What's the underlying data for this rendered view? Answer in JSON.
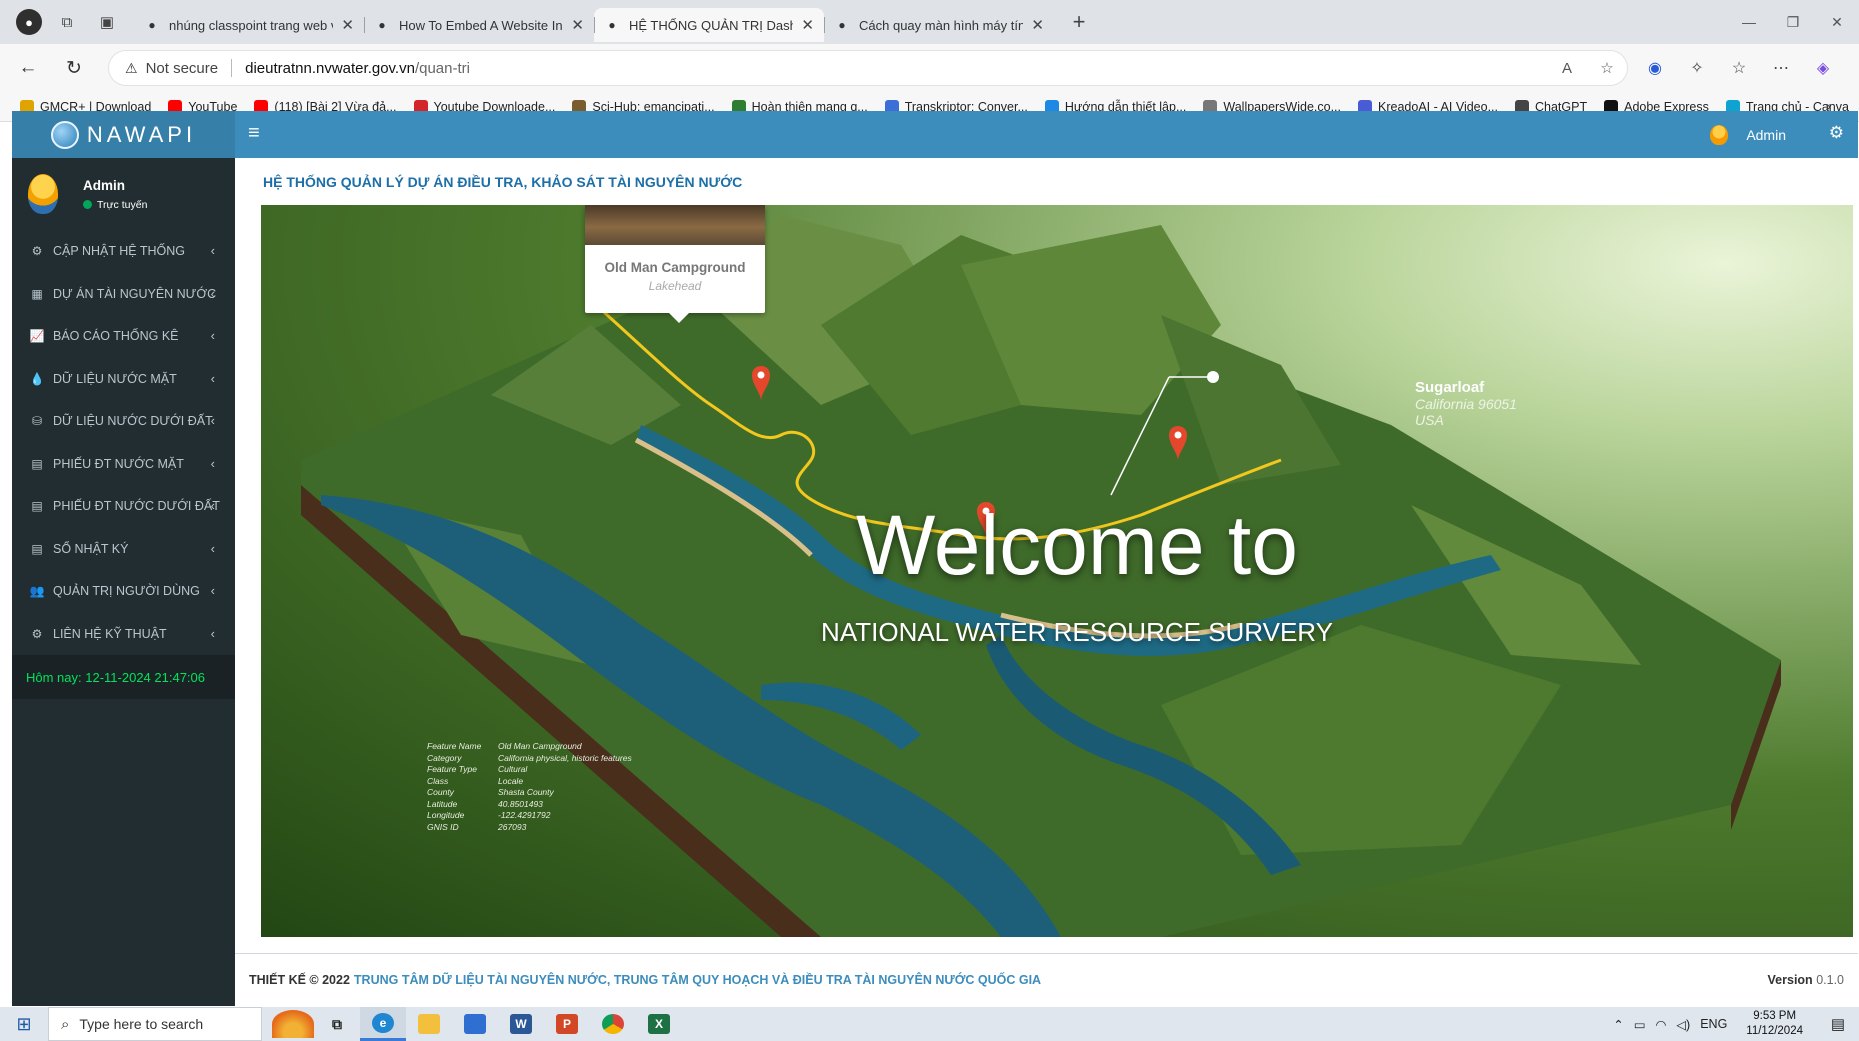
{
  "browser": {
    "tabs": [
      {
        "title": "nhúng classpoint trang web vào t",
        "favicon": "google-icon",
        "active": false
      },
      {
        "title": "How To Embed A Website In Pow",
        "favicon": "classpoint-icon",
        "active": false
      },
      {
        "title": "HỆ THỐNG QUẢN TRỊ Dashboard",
        "favicon": "page-icon",
        "active": true
      },
      {
        "title": "Cách quay màn hình máy tính nh",
        "favicon": "flash-icon",
        "active": false
      }
    ],
    "address": {
      "security_label": "Not secure",
      "host": "dieutratnn.nvwater.gov.vn",
      "path": "/quan-tri"
    },
    "bookmarks": [
      {
        "label": "GMCR+ | Download",
        "color": "#e0a400"
      },
      {
        "label": "YouTube",
        "color": "#ff0000"
      },
      {
        "label": "(118) [Bài 2] Vừa đả...",
        "color": "#ff0000"
      },
      {
        "label": "Youtube Downloade...",
        "color": "#d4252a"
      },
      {
        "label": "Sci-Hub: emancipati...",
        "color": "#7a5c2e"
      },
      {
        "label": "Hoàn thiện mạng q...",
        "color": "#2e7d32"
      },
      {
        "label": "Transkriptor: Conver...",
        "color": "#3a6fd8"
      },
      {
        "label": "Hướng dẫn thiết lập...",
        "color": "#1e88e5"
      },
      {
        "label": "WallpapersWide.co...",
        "color": "#777777"
      },
      {
        "label": "KreadoAI - AI Video...",
        "color": "#4a5bd6"
      },
      {
        "label": "ChatGPT",
        "color": "#444444"
      },
      {
        "label": "Adobe Express",
        "color": "#111111"
      },
      {
        "label": "Trang chủ - Canva",
        "color": "#0fa3d1"
      }
    ]
  },
  "app": {
    "logo_text": "NAWAPI",
    "top_user": "Admin",
    "sidebar": {
      "user_name": "Admin",
      "user_status": "Trực tuyến",
      "menu": [
        {
          "label": "CẬP NHẬT HỆ THỐNG",
          "icon": "gear-icon",
          "glyph": "⚙"
        },
        {
          "label": "DỰ ÁN TÀI NGUYÊN NƯỚC",
          "icon": "table-icon",
          "glyph": "▦"
        },
        {
          "label": "BÁO CÁO THỐNG KÊ",
          "icon": "line-chart-icon",
          "glyph": "📈"
        },
        {
          "label": "DỮ LIỆU NƯỚC MẶT",
          "icon": "water-drop-icon",
          "glyph": "💧"
        },
        {
          "label": "DỮ LIỆU NƯỚC DƯỚI ĐẤT",
          "icon": "underground-icon",
          "glyph": "⛁"
        },
        {
          "label": "PHIẾU ĐT NƯỚC MẶT",
          "icon": "document-icon",
          "glyph": "▤"
        },
        {
          "label": "PHIẾU ĐT NƯỚC DƯỚI ĐẤT",
          "icon": "document-icon",
          "glyph": "▤"
        },
        {
          "label": "SỔ NHẬT KÝ",
          "icon": "logbook-icon",
          "glyph": "▤"
        },
        {
          "label": "QUẢN TRỊ NGƯỜI DÙNG",
          "icon": "users-icon",
          "glyph": "👥"
        },
        {
          "label": "LIÊN HỆ KỸ THUẬT",
          "icon": "cogs-icon",
          "glyph": "⚙"
        }
      ],
      "today": "Hôm nay: 12-11-2024 21:47:06"
    },
    "content_title": "HỆ THỐNG QUẢN LÝ DỰ ÁN ĐIỀU TRA, KHẢO SÁT TÀI NGUYÊN NƯỚC",
    "banner": {
      "welcome": "Welcome to",
      "subtitle": "NATIONAL WATER RESOURCE SURVERY",
      "callout_name": "Old Man Campground",
      "callout_sub": "Lakehead",
      "sugarloaf_name": "Sugarloaf",
      "sugarloaf_line1": "California 96051",
      "sugarloaf_line2": "USA",
      "feature_rows": [
        {
          "k": "Feature Name",
          "v": "Old Man Campground"
        },
        {
          "k": "Category",
          "v": "California physical, historic features"
        },
        {
          "k": "Feature Type",
          "v": "Cultural"
        },
        {
          "k": "Class",
          "v": "Locale"
        },
        {
          "k": "County",
          "v": "Shasta County"
        },
        {
          "k": "Latitude",
          "v": "40.8501493"
        },
        {
          "k": "Longitude",
          "v": "-122.4291792"
        },
        {
          "k": "GNIS ID",
          "v": "267093"
        }
      ]
    },
    "footer": {
      "design": "THIẾT KẾ © 2022",
      "org": "TRUNG TÂM DỮ LIỆU TÀI NGUYÊN NƯỚC, TRUNG TÂM QUY HOẠCH VÀ ĐIỀU TRA TÀI NGUYÊN NƯỚC QUỐC GIA",
      "version_label": "Version",
      "version_value": "0.1.0"
    }
  },
  "taskbar": {
    "search_placeholder": "Type here to search",
    "language": "ENG",
    "time": "9:53 PM",
    "date": "11/12/2024"
  },
  "colors": {
    "header_blue": "#3c8dbc",
    "sidebar_dark": "#222d32",
    "today_green": "#00e35a",
    "title_blue": "#1c6fa8"
  }
}
